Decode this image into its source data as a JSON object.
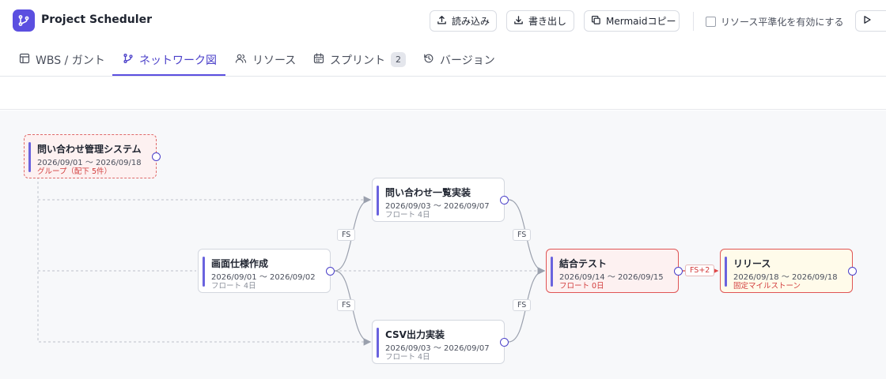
{
  "app": {
    "title": "Project Scheduler",
    "logo_icon": "git-branch-icon",
    "accent": "#5b4fe0"
  },
  "toolbar": {
    "import_label": "読み込み",
    "export_label": "書き出し",
    "mermaid_label": "Mermaidコピー",
    "leveling_label": "リソース平準化を有効にする",
    "leveling_checked": false
  },
  "tabs": [
    {
      "label": "WBS / ガント",
      "icon": "table-icon",
      "active": false
    },
    {
      "label": "ネットワーク図",
      "icon": "branch-icon",
      "active": true
    },
    {
      "label": "リソース",
      "icon": "users-icon",
      "active": false
    },
    {
      "label": "スプリント",
      "icon": "calendar-icon",
      "active": false,
      "badge": "2"
    },
    {
      "label": "バージョン",
      "icon": "history-icon",
      "active": false
    }
  ],
  "network": {
    "nodes": [
      {
        "id": "g",
        "title": "問い合わせ管理システム",
        "dates": "2026/09/01 〜 2026/09/18",
        "sub": "グループ（配下 5件）",
        "kind": "group"
      },
      {
        "id": "a",
        "title": "画面仕様作成",
        "dates": "2026/09/01 〜 2026/09/02",
        "sub": "フロート 4日",
        "kind": "normal"
      },
      {
        "id": "b",
        "title": "問い合わせ一覧実装",
        "dates": "2026/09/03 〜 2026/09/07",
        "sub": "フロート 4日",
        "kind": "normal"
      },
      {
        "id": "c",
        "title": "CSV出力実装",
        "dates": "2026/09/03 〜 2026/09/07",
        "sub": "フロート 4日",
        "kind": "normal"
      },
      {
        "id": "d",
        "title": "結合テスト",
        "dates": "2026/09/14 〜 2026/09/15",
        "sub": "フロート 0日",
        "kind": "critical"
      },
      {
        "id": "e",
        "title": "リリース",
        "dates": "2026/09/18 〜 2026/09/18",
        "sub": "固定マイルストーン",
        "kind": "milestone"
      }
    ],
    "edges": [
      {
        "from": "a",
        "to": "b",
        "label": "FS"
      },
      {
        "from": "a",
        "to": "c",
        "label": "FS"
      },
      {
        "from": "b",
        "to": "d",
        "label": "FS"
      },
      {
        "from": "c",
        "to": "d",
        "label": "FS"
      },
      {
        "from": "d",
        "to": "e",
        "label": "FS+2",
        "critical": true
      }
    ],
    "colors": {
      "edge": "#9aa0ad",
      "critical": "#e04848",
      "port": "#4b40c9"
    }
  }
}
